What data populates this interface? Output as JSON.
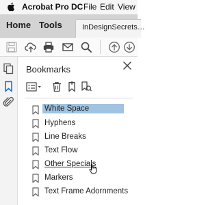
{
  "menubar": {
    "apple_icon": "apple-logo-icon",
    "app_name": "Acrobat Pro DC",
    "menus": [
      "File",
      "Edit",
      "View"
    ]
  },
  "tabbar": {
    "home": "Home",
    "tools": "Tools",
    "document_tab": "InDesignSecrets…"
  },
  "toolbar": {
    "icons": [
      "save-icon",
      "cloud-upload-icon",
      "print-icon",
      "mail-icon",
      "search-icon",
      "scroll-up-icon",
      "scroll-down-icon"
    ]
  },
  "rail": {
    "icons": [
      "page-thumbnails-icon",
      "bookmark-icon",
      "attachment-icon"
    ]
  },
  "panel": {
    "title": "Bookmarks",
    "close_icon": "close-icon",
    "tools": [
      "options-menu-icon",
      "delete-bookmark-icon",
      "new-bookmark-icon",
      "new-bookmark-from-structure-icon"
    ],
    "bookmarks": [
      {
        "label": "White Space",
        "state": "selected"
      },
      {
        "label": "Hyphens",
        "state": "normal"
      },
      {
        "label": "Line Breaks",
        "state": "normal"
      },
      {
        "label": "Text Flow",
        "state": "normal"
      },
      {
        "label": "Other Specials",
        "state": "hover"
      },
      {
        "label": "Markers",
        "state": "normal"
      },
      {
        "label": "Text Frame Adornments",
        "state": "normal"
      }
    ],
    "cursor_icon": "hand-pointer-icon"
  },
  "colors": {
    "selection": "#9fc3e1",
    "active_rail_icon": "#1473e6",
    "tabbar_bg": "#d3d3d3"
  }
}
